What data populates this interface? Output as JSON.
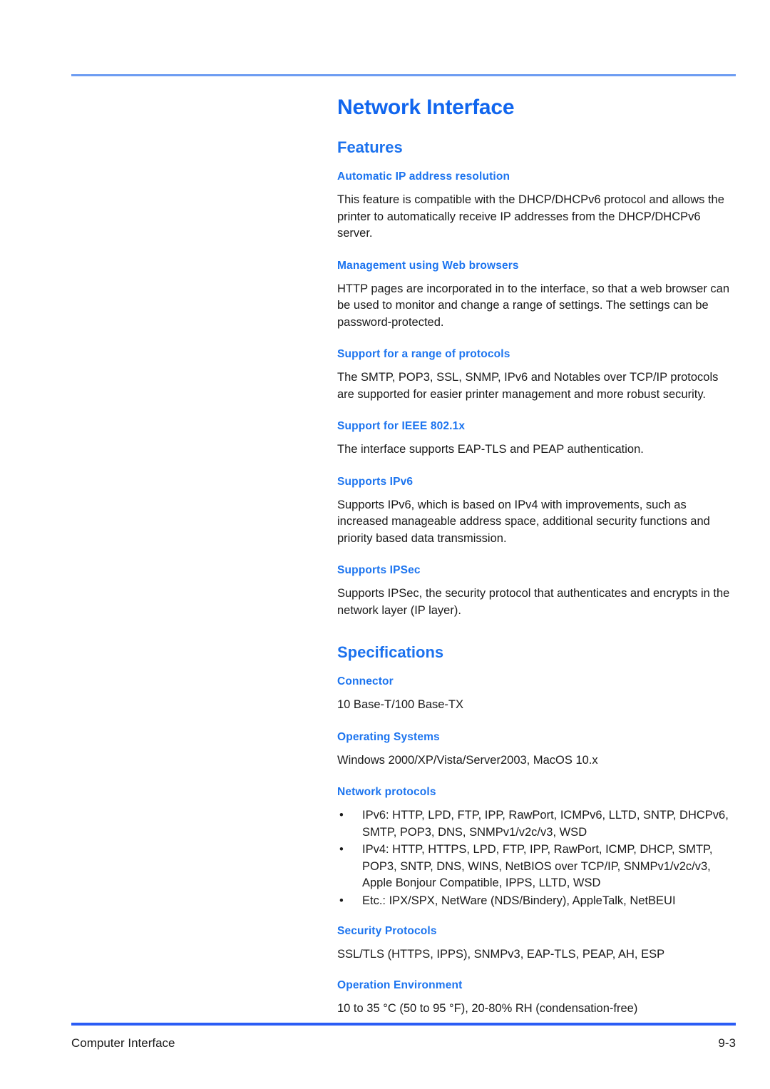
{
  "document": {
    "title": "Network Interface",
    "accent_title_color": "#1166ee",
    "accent_heading_color": "#1c74ef",
    "rule_top_color": "#6d9cf2",
    "rule_footer_color": "#2a5cf5"
  },
  "sections": {
    "features": {
      "heading": "Features",
      "items": [
        {
          "heading": "Automatic IP address resolution",
          "body": "This feature is compatible with the DHCP/DHCPv6 protocol and allows the printer to automatically receive IP addresses from the DHCP/DHCPv6 server."
        },
        {
          "heading": "Management using Web browsers",
          "body": "HTTP pages are incorporated in to the interface, so that a web browser can be used to monitor and change a range of settings. The settings can be password-protected."
        },
        {
          "heading": "Support for a range of protocols",
          "body": "The SMTP, POP3, SSL, SNMP, IPv6 and Notables over TCP/IP protocols are supported for easier printer management and more robust security."
        },
        {
          "heading": "Support for IEEE 802.1x",
          "body": "The interface supports EAP-TLS and PEAP authentication."
        },
        {
          "heading": "Supports IPv6",
          "body": "Supports IPv6, which is based on IPv4 with improvements, such as increased manageable address space, additional security functions and priority based data transmission."
        },
        {
          "heading": "Supports IPSec",
          "body": "Supports IPSec, the security protocol that authenticates and encrypts in the network layer (IP layer)."
        }
      ]
    },
    "specifications": {
      "heading": "Specifications",
      "connector": {
        "heading": "Connector",
        "value": "10 Base-T/100 Base-TX"
      },
      "operating_systems": {
        "heading": "Operating Systems",
        "value": "Windows 2000/XP/Vista/Server2003, MacOS 10.x"
      },
      "network_protocols": {
        "heading": "Network protocols",
        "bullet_glyph": "•",
        "items": [
          "IPv6: HTTP, LPD, FTP, IPP, RawPort, ICMPv6, LLTD, SNTP, DHCPv6, SMTP, POP3, DNS, SNMPv1/v2c/v3, WSD",
          "IPv4: HTTP, HTTPS, LPD, FTP, IPP, RawPort, ICMP, DHCP, SMTP, POP3, SNTP, DNS, WINS, NetBIOS over TCP/IP, SNMPv1/v2c/v3, Apple Bonjour Compatible, IPPS, LLTD, WSD",
          "Etc.: IPX/SPX, NetWare (NDS/Bindery), AppleTalk, NetBEUI"
        ]
      },
      "security_protocols": {
        "heading": "Security Protocols",
        "value": "SSL/TLS (HTTPS, IPPS), SNMPv3, EAP-TLS, PEAP, AH, ESP"
      },
      "operation_environment": {
        "heading": "Operation Environment",
        "value": "10 to 35 °C (50 to 95 °F), 20-80% RH (condensation-free)"
      }
    }
  },
  "footer": {
    "left_label": "Computer Interface",
    "page_number": "9-3"
  }
}
